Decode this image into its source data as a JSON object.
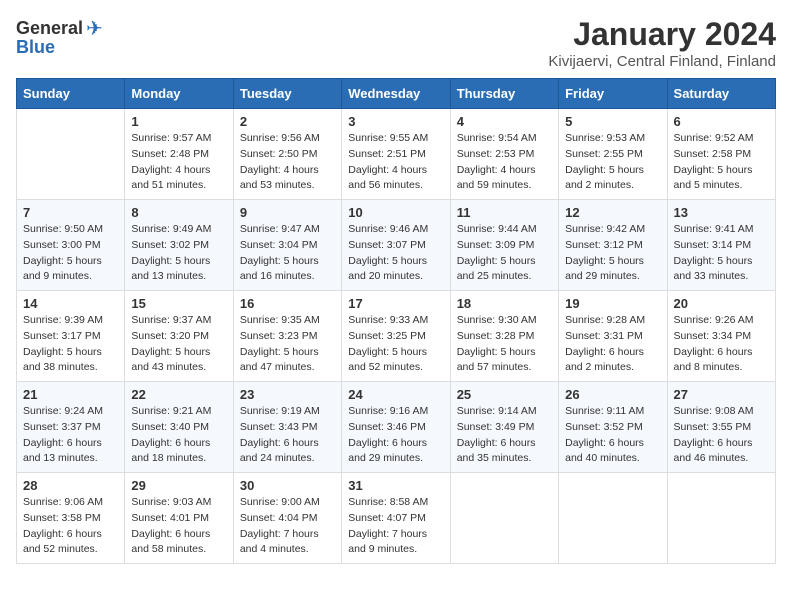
{
  "logo": {
    "general": "General",
    "blue": "Blue"
  },
  "title": "January 2024",
  "subtitle": "Kivijaervi, Central Finland, Finland",
  "days_header": [
    "Sunday",
    "Monday",
    "Tuesday",
    "Wednesday",
    "Thursday",
    "Friday",
    "Saturday"
  ],
  "weeks": [
    [
      {
        "num": "",
        "info": ""
      },
      {
        "num": "1",
        "info": "Sunrise: 9:57 AM\nSunset: 2:48 PM\nDaylight: 4 hours\nand 51 minutes."
      },
      {
        "num": "2",
        "info": "Sunrise: 9:56 AM\nSunset: 2:50 PM\nDaylight: 4 hours\nand 53 minutes."
      },
      {
        "num": "3",
        "info": "Sunrise: 9:55 AM\nSunset: 2:51 PM\nDaylight: 4 hours\nand 56 minutes."
      },
      {
        "num": "4",
        "info": "Sunrise: 9:54 AM\nSunset: 2:53 PM\nDaylight: 4 hours\nand 59 minutes."
      },
      {
        "num": "5",
        "info": "Sunrise: 9:53 AM\nSunset: 2:55 PM\nDaylight: 5 hours\nand 2 minutes."
      },
      {
        "num": "6",
        "info": "Sunrise: 9:52 AM\nSunset: 2:58 PM\nDaylight: 5 hours\nand 5 minutes."
      }
    ],
    [
      {
        "num": "7",
        "info": "Sunrise: 9:50 AM\nSunset: 3:00 PM\nDaylight: 5 hours\nand 9 minutes."
      },
      {
        "num": "8",
        "info": "Sunrise: 9:49 AM\nSunset: 3:02 PM\nDaylight: 5 hours\nand 13 minutes."
      },
      {
        "num": "9",
        "info": "Sunrise: 9:47 AM\nSunset: 3:04 PM\nDaylight: 5 hours\nand 16 minutes."
      },
      {
        "num": "10",
        "info": "Sunrise: 9:46 AM\nSunset: 3:07 PM\nDaylight: 5 hours\nand 20 minutes."
      },
      {
        "num": "11",
        "info": "Sunrise: 9:44 AM\nSunset: 3:09 PM\nDaylight: 5 hours\nand 25 minutes."
      },
      {
        "num": "12",
        "info": "Sunrise: 9:42 AM\nSunset: 3:12 PM\nDaylight: 5 hours\nand 29 minutes."
      },
      {
        "num": "13",
        "info": "Sunrise: 9:41 AM\nSunset: 3:14 PM\nDaylight: 5 hours\nand 33 minutes."
      }
    ],
    [
      {
        "num": "14",
        "info": "Sunrise: 9:39 AM\nSunset: 3:17 PM\nDaylight: 5 hours\nand 38 minutes."
      },
      {
        "num": "15",
        "info": "Sunrise: 9:37 AM\nSunset: 3:20 PM\nDaylight: 5 hours\nand 43 minutes."
      },
      {
        "num": "16",
        "info": "Sunrise: 9:35 AM\nSunset: 3:23 PM\nDaylight: 5 hours\nand 47 minutes."
      },
      {
        "num": "17",
        "info": "Sunrise: 9:33 AM\nSunset: 3:25 PM\nDaylight: 5 hours\nand 52 minutes."
      },
      {
        "num": "18",
        "info": "Sunrise: 9:30 AM\nSunset: 3:28 PM\nDaylight: 5 hours\nand 57 minutes."
      },
      {
        "num": "19",
        "info": "Sunrise: 9:28 AM\nSunset: 3:31 PM\nDaylight: 6 hours\nand 2 minutes."
      },
      {
        "num": "20",
        "info": "Sunrise: 9:26 AM\nSunset: 3:34 PM\nDaylight: 6 hours\nand 8 minutes."
      }
    ],
    [
      {
        "num": "21",
        "info": "Sunrise: 9:24 AM\nSunset: 3:37 PM\nDaylight: 6 hours\nand 13 minutes."
      },
      {
        "num": "22",
        "info": "Sunrise: 9:21 AM\nSunset: 3:40 PM\nDaylight: 6 hours\nand 18 minutes."
      },
      {
        "num": "23",
        "info": "Sunrise: 9:19 AM\nSunset: 3:43 PM\nDaylight: 6 hours\nand 24 minutes."
      },
      {
        "num": "24",
        "info": "Sunrise: 9:16 AM\nSunset: 3:46 PM\nDaylight: 6 hours\nand 29 minutes."
      },
      {
        "num": "25",
        "info": "Sunrise: 9:14 AM\nSunset: 3:49 PM\nDaylight: 6 hours\nand 35 minutes."
      },
      {
        "num": "26",
        "info": "Sunrise: 9:11 AM\nSunset: 3:52 PM\nDaylight: 6 hours\nand 40 minutes."
      },
      {
        "num": "27",
        "info": "Sunrise: 9:08 AM\nSunset: 3:55 PM\nDaylight: 6 hours\nand 46 minutes."
      }
    ],
    [
      {
        "num": "28",
        "info": "Sunrise: 9:06 AM\nSunset: 3:58 PM\nDaylight: 6 hours\nand 52 minutes."
      },
      {
        "num": "29",
        "info": "Sunrise: 9:03 AM\nSunset: 4:01 PM\nDaylight: 6 hours\nand 58 minutes."
      },
      {
        "num": "30",
        "info": "Sunrise: 9:00 AM\nSunset: 4:04 PM\nDaylight: 7 hours\nand 4 minutes."
      },
      {
        "num": "31",
        "info": "Sunrise: 8:58 AM\nSunset: 4:07 PM\nDaylight: 7 hours\nand 9 minutes."
      },
      {
        "num": "",
        "info": ""
      },
      {
        "num": "",
        "info": ""
      },
      {
        "num": "",
        "info": ""
      }
    ]
  ]
}
